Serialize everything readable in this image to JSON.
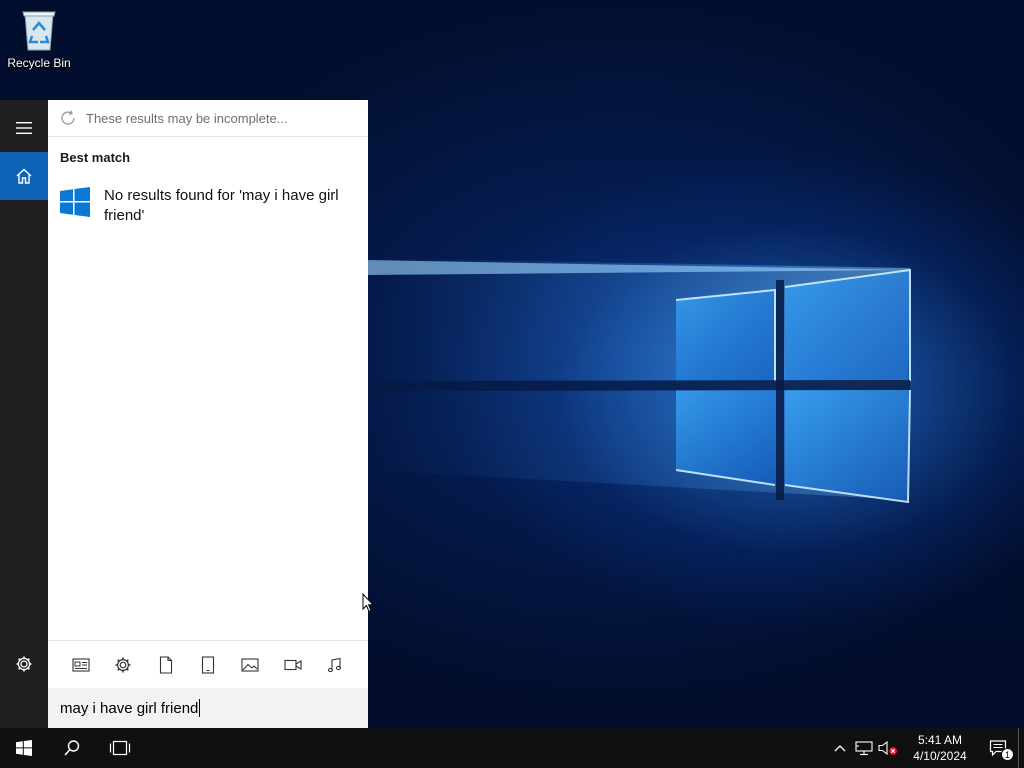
{
  "desktop": {
    "icons": [
      {
        "label": "Recycle Bin",
        "icon": "recycle-bin-icon"
      }
    ]
  },
  "start_rail": {
    "items": [
      {
        "name": "menu",
        "icon": "hamburger-menu-icon"
      },
      {
        "name": "home",
        "icon": "home-icon",
        "active": true
      },
      {
        "name": "settings",
        "icon": "gear-icon"
      }
    ]
  },
  "search_panel": {
    "notice": "These results may be incomplete...",
    "best_match_title": "Best match",
    "result_message": "No results found for 'may i have girl friend'",
    "filters": [
      {
        "name": "apps",
        "icon": "apps-icon"
      },
      {
        "name": "settings",
        "icon": "gear-icon"
      },
      {
        "name": "documents",
        "icon": "document-icon"
      },
      {
        "name": "folders",
        "icon": "tablet-icon"
      },
      {
        "name": "photos",
        "icon": "photo-icon"
      },
      {
        "name": "videos",
        "icon": "video-icon"
      },
      {
        "name": "music",
        "icon": "music-icon"
      }
    ]
  },
  "search_box": {
    "query": "may i have girl friend"
  },
  "taskbar": {
    "buttons": [
      {
        "name": "start",
        "icon": "windows-logo-icon"
      },
      {
        "name": "search",
        "icon": "search-icon"
      },
      {
        "name": "task-view",
        "icon": "task-view-icon"
      }
    ],
    "tray": {
      "icons": [
        "chevron-up-icon",
        "network-icon",
        "volume-muted-icon"
      ],
      "time": "5:41 AM",
      "date": "4/10/2024",
      "notification_count": "1"
    }
  },
  "colors": {
    "accent": "#0f63b6",
    "rail": "#1f1f1f",
    "taskbar": "#101010",
    "windows_blue": "#0a78d4"
  }
}
